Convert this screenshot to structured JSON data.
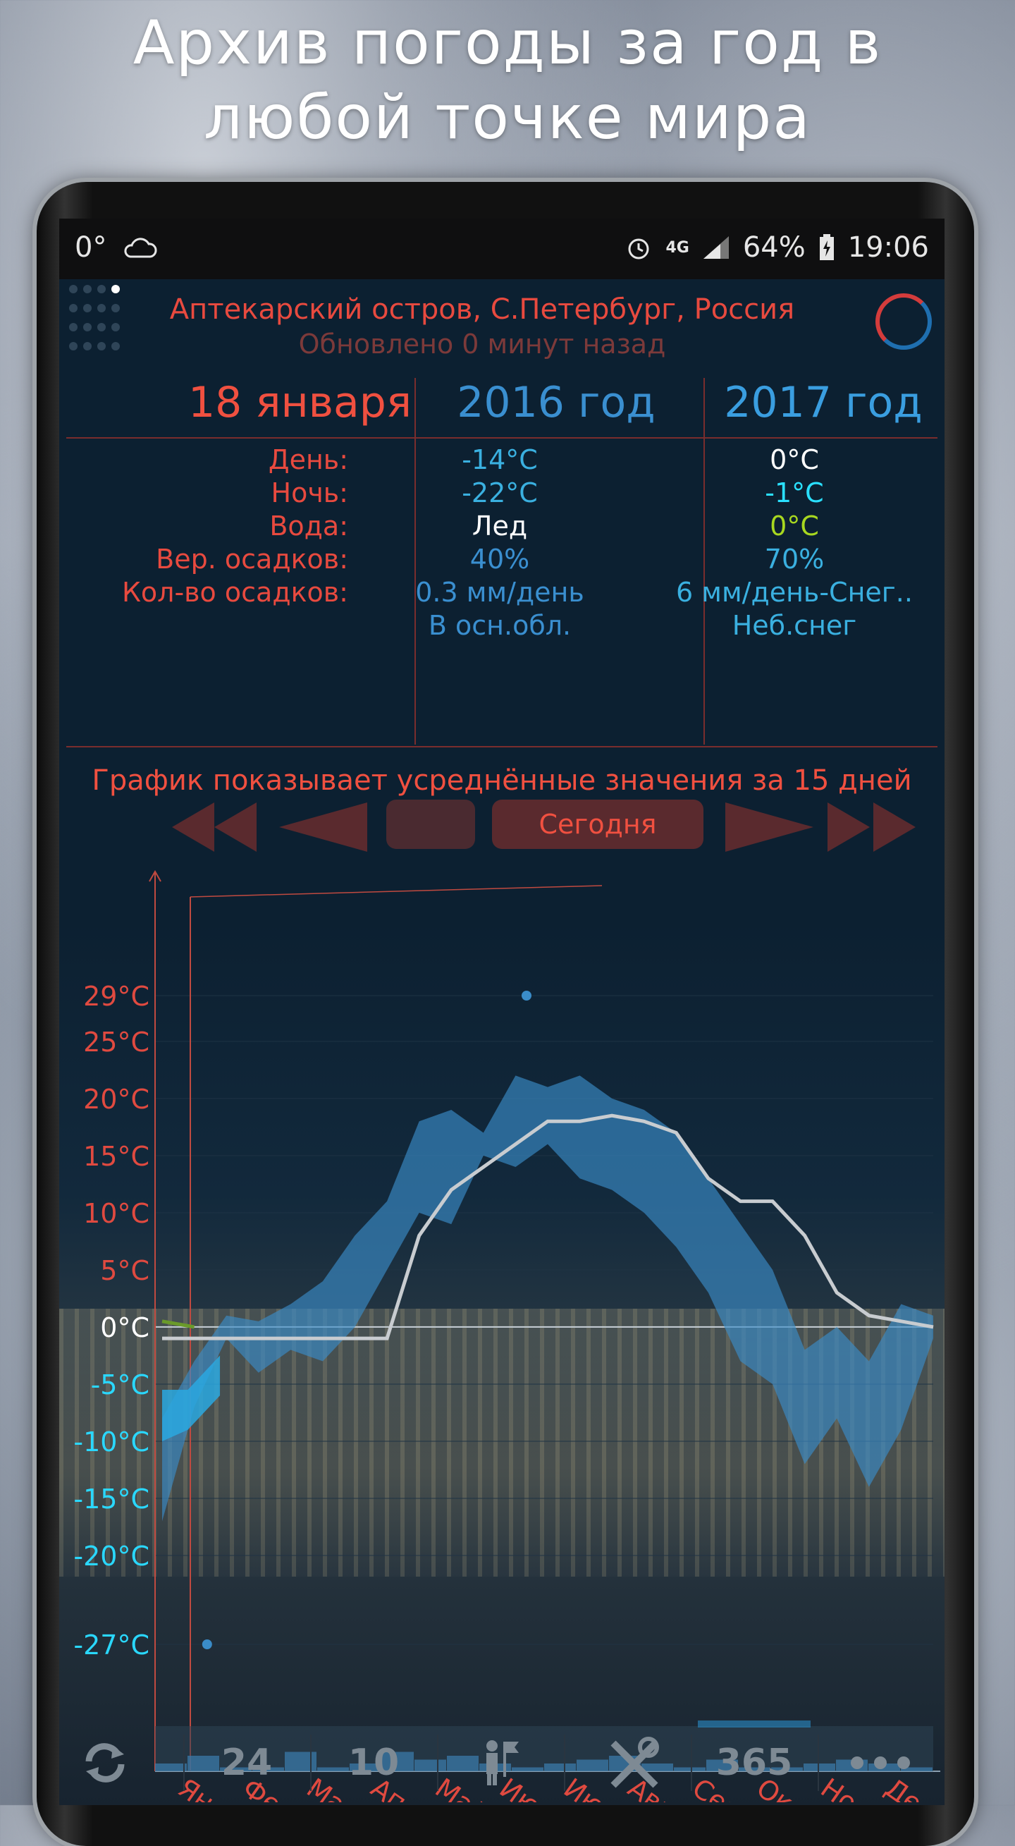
{
  "promo": {
    "headline_line1": "Архив погоды за год в",
    "headline_line2": "любой точке мира"
  },
  "status_bar": {
    "temp": "0°",
    "network": "4G",
    "battery": "64%",
    "time": "19:06"
  },
  "header": {
    "location": "Аптекарский остров, С.Петербург, Россия",
    "updated": "Обновлено 0 минут назад"
  },
  "table": {
    "date": "18 января",
    "year1": "2016 год",
    "year2": "2017 год",
    "rows": [
      {
        "label": "День:",
        "v1": "-14°C",
        "v2": "0°C",
        "c1": "#3ab0e0",
        "c2": "#ffffff"
      },
      {
        "label": "Ночь:",
        "v1": "-22°C",
        "v2": "-1°C",
        "c1": "#3ab0e0",
        "c2": "#2ae0ff"
      },
      {
        "label": "Вода:",
        "v1": "Лед",
        "v2": "0°C",
        "c1": "#ffffff",
        "c2": "#a8d820"
      },
      {
        "label": "Вер. осадков:",
        "v1": "40%",
        "v2": "70%",
        "c1": "#3a8fd0",
        "c2": "#3ab0e0"
      },
      {
        "label": "Кол-во осадков:",
        "v1": "0.3 мм/день",
        "v2": "6 мм/день-Снег..",
        "c1": "#3a8fd0",
        "c2": "#3ab0e0"
      },
      {
        "label": "",
        "v1": "В осн.обл.",
        "v2": "Неб.снег",
        "c1": "#3a8fd0",
        "c2": "#3ab0e0"
      }
    ]
  },
  "chart_note": "График показывает усреднённые значения за 15 дней",
  "nav": {
    "today": "Сегодня"
  },
  "chart_data": {
    "type": "line",
    "title": "",
    "xlabel": "",
    "ylabel": "",
    "y_ticks": [
      "29°C",
      "25°C",
      "20°C",
      "15°C",
      "10°C",
      "5°C",
      "0°C",
      "-5°C",
      "-10°C",
      "-15°C",
      "-20°C",
      "-27°C"
    ],
    "y_tick_values": [
      29,
      25,
      20,
      15,
      10,
      5,
      0,
      -5,
      -10,
      -15,
      -20,
      -27
    ],
    "months": [
      "Янв",
      "Фев",
      "Мар",
      "Апр",
      "Май",
      "Июн",
      "Июл",
      "Авг",
      "Сен",
      "Окт",
      "Ноя",
      "Дек"
    ],
    "ylim": [
      -29,
      31
    ],
    "band_x": [
      0,
      0.5,
      1,
      1.5,
      2,
      2.5,
      3,
      3.5,
      4,
      4.5,
      5,
      5.5,
      6,
      6.5,
      7,
      7.5,
      8,
      8.5,
      9,
      9.5,
      10,
      10.5,
      11,
      11.5,
      12
    ],
    "band_high": [
      -8,
      -3,
      1,
      0.5,
      2,
      4,
      8,
      11,
      18,
      19,
      17,
      22,
      21,
      22,
      20,
      19,
      17,
      13,
      9,
      5,
      -2,
      0,
      -3,
      2,
      1
    ],
    "band_low": [
      -17,
      -7,
      -1,
      -4,
      -2,
      -3,
      0,
      5,
      10,
      9,
      15,
      14,
      16,
      13,
      12,
      10,
      7,
      3,
      -3,
      -5,
      -12,
      -8,
      -14,
      -9,
      -1
    ],
    "avg_line_x": [
      0,
      0.5,
      1,
      1.5,
      2,
      2.5,
      3,
      3.5,
      4,
      4.5,
      5,
      5.5,
      6,
      6.5,
      7,
      7.5,
      8,
      8.5,
      9,
      9.5,
      10,
      10.5,
      11,
      11.5,
      12
    ],
    "avg_line": [
      -1,
      -1,
      -1,
      -1,
      -1,
      -1,
      -1,
      -1,
      8,
      12,
      14,
      16,
      18,
      18,
      18.5,
      18,
      17,
      13,
      11,
      11,
      8,
      3,
      1,
      0.5,
      0
    ],
    "current_2017": {
      "x": [
        0,
        0.5
      ],
      "y": [
        0.5,
        0
      ]
    },
    "current_band_x": [
      0,
      0.4,
      0.9
    ],
    "current_band_high": [
      -5.5,
      -5.5,
      -2.5
    ],
    "current_band_low": [
      -10,
      -9,
      -6
    ],
    "max_point": {
      "x": 6,
      "y": 29
    },
    "min_point": {
      "x": 0.7,
      "y": -27
    },
    "precip_bars": [
      0.1,
      0.2,
      0.05,
      0.05,
      0.25,
      0.05,
      0.1,
      0.25,
      0.15,
      0.2,
      0.1,
      0.05,
      0.1,
      0.15,
      0.2,
      0.1,
      0.05,
      0.15,
      0.05,
      0.05,
      0.1,
      0.15,
      0.1,
      0.05
    ],
    "colors": {
      "band": "#3a8cc8",
      "avg_line": "#c8ccd0",
      "current_line": "#6a9a2a",
      "axis": "#c04a40",
      "tick_neg": "#2ad8ff",
      "tick_pos": "#e04a40",
      "zero": "#ffffff"
    }
  },
  "bottom_bar": {
    "items": [
      "24",
      "10",
      "365"
    ]
  }
}
